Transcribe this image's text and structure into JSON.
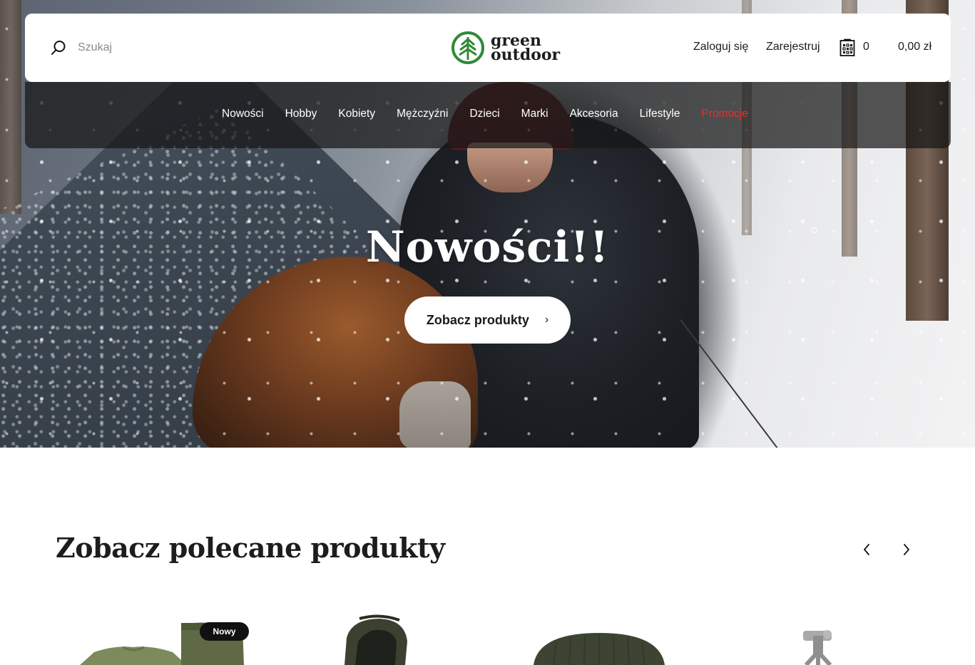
{
  "header": {
    "search_placeholder": "Szukaj",
    "logo": {
      "line1": "green",
      "line2": "outdoor",
      "color": "#2f8a36"
    },
    "login": "Zaloguj się",
    "register": "Zarejestruj",
    "cart_count": "0",
    "cart_total": "0,00 zł"
  },
  "nav": {
    "items": [
      "Nowości",
      "Hobby",
      "Kobiety",
      "Mężczyźni",
      "Dzieci",
      "Marki",
      "Akcesoria",
      "Lifestyle",
      "Promocje"
    ],
    "promo_color": "#e53030"
  },
  "hero": {
    "title": "Nowości!!",
    "button_label": "Zobacz produkty"
  },
  "featured": {
    "title": "Zobacz polecane produkty",
    "badge_new": "Nowy"
  },
  "icons": {
    "search": "search-icon",
    "cart": "cart-icon",
    "logo": "tree-icon",
    "prev": "chevron-left-icon",
    "next": "chevron-right-icon"
  }
}
